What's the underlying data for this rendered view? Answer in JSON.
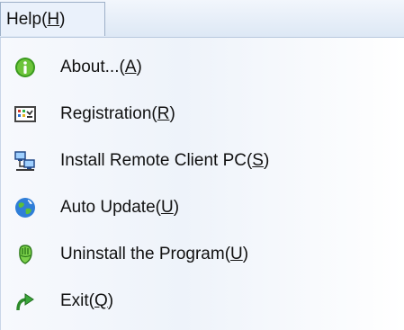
{
  "menubar": {
    "menu": {
      "label": "Help(",
      "key": "H",
      "close": ")"
    }
  },
  "items": [
    {
      "label": "About...(",
      "key": "A",
      "close": ")",
      "icon": "info-icon"
    },
    {
      "label": "Registration(",
      "key": "R",
      "close": ")",
      "icon": "registration-icon"
    },
    {
      "label": "Install Remote Client PC(",
      "key": "S",
      "close": ")",
      "icon": "network-computers-icon"
    },
    {
      "label": "Auto Update(",
      "key": "U",
      "close": ")",
      "icon": "globe-update-icon"
    },
    {
      "label": "Uninstall the Program(",
      "key": "U",
      "close": ")",
      "icon": "uninstall-icon"
    },
    {
      "label": "Exit(",
      "key": "Q",
      "close": ")",
      "icon": "exit-arrow-icon"
    }
  ]
}
